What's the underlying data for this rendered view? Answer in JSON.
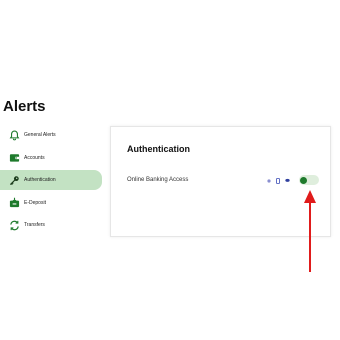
{
  "page": {
    "title": "Alerts"
  },
  "sidebar": {
    "items": [
      {
        "label": "General Alerts",
        "icon": "bell-icon",
        "active": false
      },
      {
        "label": "Accounts",
        "icon": "wallet-icon",
        "active": false
      },
      {
        "label": "Authentication",
        "icon": "key-icon",
        "active": true
      },
      {
        "label": "E-Deposit",
        "icon": "deposit-icon",
        "active": false
      },
      {
        "label": "Transfers",
        "icon": "transfer-icon",
        "active": false
      }
    ]
  },
  "card": {
    "title": "Authentication",
    "setting": {
      "label": "Online Banking Access",
      "channels": [
        "email-icon",
        "phone-icon",
        "message-icon"
      ],
      "toggle": "on"
    }
  },
  "colors": {
    "accent": "#1e7a2c",
    "active_bg": "#c3e2c3",
    "toggle_track": "#dfeedd",
    "arrow": "#e01b1b",
    "channel_icon": "#3a4bb5"
  }
}
